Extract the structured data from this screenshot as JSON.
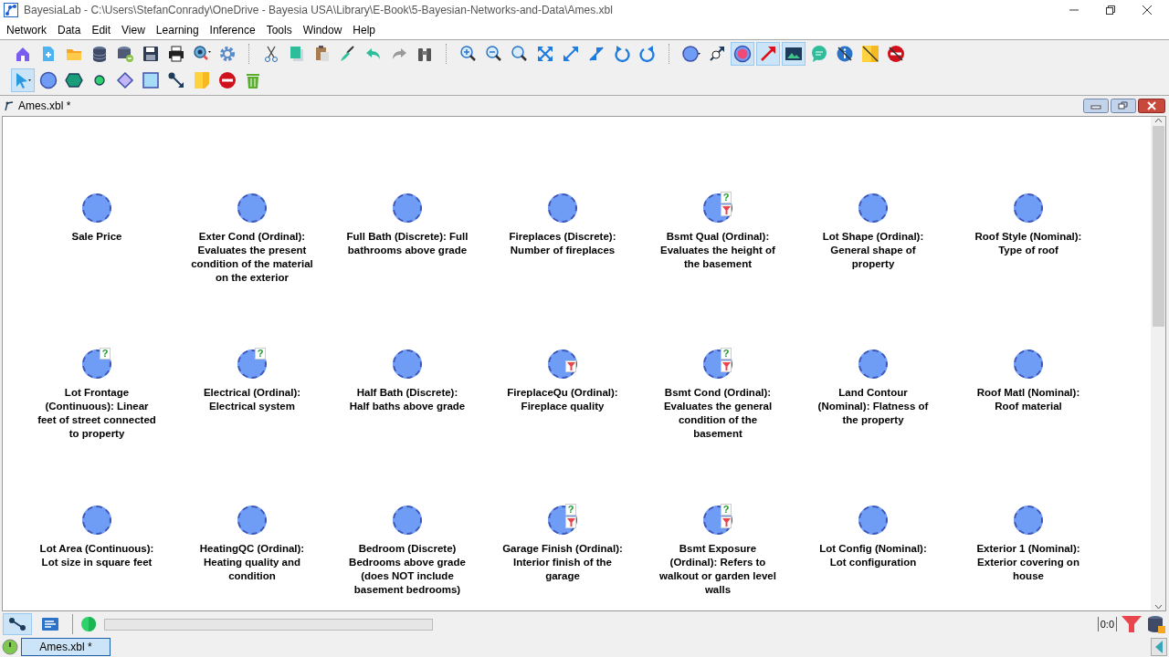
{
  "window": {
    "title": "BayesiaLab - C:\\Users\\StefanConrady\\OneDrive - Bayesia USA\\Library\\E-Book\\5-Bayesian-Networks-and-Data\\Ames.xbl"
  },
  "menu": [
    "Network",
    "Data",
    "Edit",
    "View",
    "Learning",
    "Inference",
    "Tools",
    "Window",
    "Help"
  ],
  "toolbar_1": [
    {
      "kind": "home",
      "selected": false
    },
    {
      "kind": "new",
      "selected": false
    },
    {
      "kind": "open",
      "selected": false
    },
    {
      "kind": "database",
      "selected": false
    },
    {
      "kind": "dbexport",
      "selected": false
    },
    {
      "kind": "save",
      "selected": false
    },
    {
      "kind": "print",
      "selected": false
    },
    {
      "kind": "inspect",
      "selected": false
    },
    {
      "kind": "gear",
      "selected": false
    },
    {
      "kind": "cut",
      "selected": false
    },
    {
      "kind": "copy",
      "selected": false
    },
    {
      "kind": "paste",
      "selected": false
    },
    {
      "kind": "brush",
      "selected": false
    },
    {
      "kind": "undo",
      "selected": false
    },
    {
      "kind": "redo",
      "selected": false
    },
    {
      "kind": "binoculars",
      "selected": false
    },
    {
      "kind": "zoomin",
      "selected": false
    },
    {
      "kind": "zoomout",
      "selected": false
    },
    {
      "kind": "zoomfit",
      "selected": false
    },
    {
      "kind": "expand",
      "selected": false
    },
    {
      "kind": "diagexpand",
      "selected": false
    },
    {
      "kind": "diagshrink",
      "selected": false
    },
    {
      "kind": "rotleft",
      "selected": false
    },
    {
      "kind": "rotright",
      "selected": false
    },
    {
      "kind": "nodestyle",
      "selected": false
    },
    {
      "kind": "arcinfo",
      "selected": false
    },
    {
      "kind": "pinknode",
      "selected": true
    },
    {
      "kind": "redarrow",
      "selected": true
    },
    {
      "kind": "image",
      "selected": true
    },
    {
      "kind": "comment",
      "selected": false
    },
    {
      "kind": "infooff",
      "selected": false
    },
    {
      "kind": "noteoff",
      "selected": false
    },
    {
      "kind": "stopoff",
      "selected": false
    }
  ],
  "toolbar_2": [
    {
      "kind": "pointer",
      "selected": true
    },
    {
      "kind": "circle",
      "selected": false
    },
    {
      "kind": "hexagon",
      "selected": false
    },
    {
      "kind": "smallcircle",
      "selected": false
    },
    {
      "kind": "diamond",
      "selected": false
    },
    {
      "kind": "square",
      "selected": false
    },
    {
      "kind": "arc",
      "selected": false
    },
    {
      "kind": "note",
      "selected": false
    },
    {
      "kind": "stop",
      "selected": false
    },
    {
      "kind": "trash",
      "selected": false
    }
  ],
  "document": {
    "title": "Ames.xbl *"
  },
  "nodes": [
    {
      "label": "Sale Price",
      "filtered": false
    },
    {
      "label": "Exter Cond (Ordinal): Evaluates the present condition of the material on the exterior",
      "filtered": false
    },
    {
      "label": "Full Bath (Discrete): Full bathrooms above grade",
      "filtered": false
    },
    {
      "label": "Fireplaces (Discrete): Number of fireplaces",
      "filtered": false
    },
    {
      "label": "Bsmt Qual (Ordinal): Evaluates the height of the basement",
      "missing_mark": "?",
      "filtered": true
    },
    {
      "label": "Lot Shape (Ordinal): General shape of property",
      "filtered": false
    },
    {
      "label": "Roof Style (Nominal): Type of roof",
      "filtered": false
    },
    {
      "label": "Lot Frontage (Continuous): Linear feet of street connected to property",
      "missing_mark": "?",
      "filtered": false
    },
    {
      "label": "Electrical (Ordinal): Electrical system",
      "missing_mark": "?",
      "filtered": false
    },
    {
      "label": "Half Bath (Discrete): Half baths above grade",
      "filtered": false
    },
    {
      "label": "FireplaceQu (Ordinal): Fireplace quality",
      "filtered": true
    },
    {
      "label": "Bsmt Cond (Ordinal): Evaluates the general condition of the basement",
      "missing_mark": "?",
      "filtered": true
    },
    {
      "label": "Land Contour (Nominal): Flatness of the property",
      "filtered": false
    },
    {
      "label": "Roof Matl (Nominal): Roof material",
      "filtered": false
    },
    {
      "label": "Lot Area (Continuous): Lot size in square feet",
      "filtered": false
    },
    {
      "label": "HeatingQC (Ordinal): Heating quality and condition",
      "filtered": false
    },
    {
      "label": "Bedroom (Discrete) Bedrooms above grade (does NOT include basement bedrooms)",
      "filtered": false
    },
    {
      "label": "Garage Finish (Ordinal): Interior finish of the garage",
      "missing_mark": "?",
      "filtered": true
    },
    {
      "label": "Bsmt Exposure (Ordinal): Refers to walkout or garden level walls",
      "missing_mark": "?",
      "filtered": true
    },
    {
      "label": "Lot Config (Nominal): Lot configuration",
      "filtered": false
    },
    {
      "label": "Exterior 1 (Nominal): Exterior covering on house",
      "filtered": false
    }
  ],
  "status_bar": {
    "modes": [
      {
        "kind": "graph",
        "selected": true
      },
      {
        "kind": "monitor",
        "selected": false
      }
    ],
    "progress": {
      "level": 0
    },
    "counter": "0:0"
  },
  "taskbar": {
    "tabs": [
      {
        "label": "Ames.xbl *",
        "selected": true
      }
    ]
  }
}
